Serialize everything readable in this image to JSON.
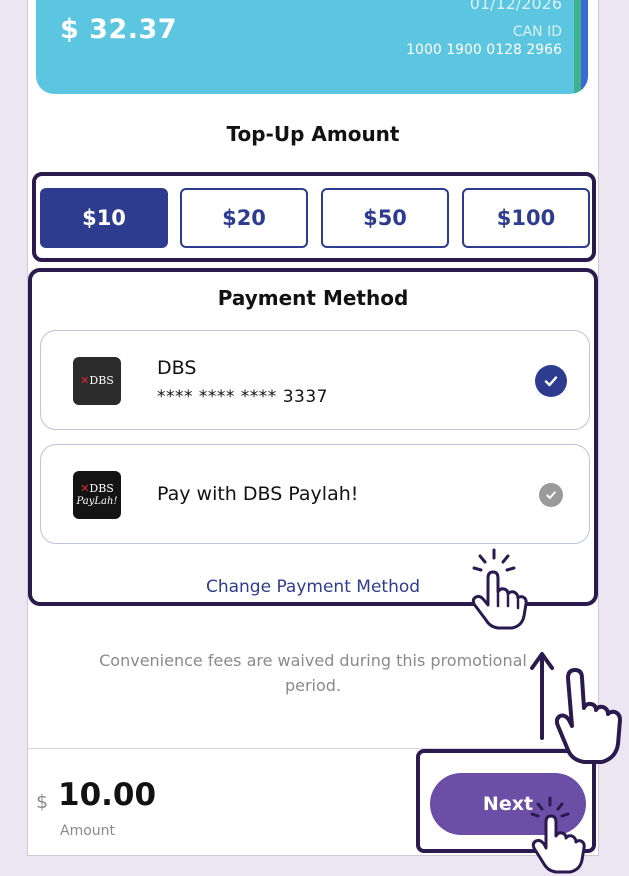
{
  "card": {
    "balance": "$ 32.37",
    "date": "01/12/2026",
    "can_label": "CAN ID",
    "can_id": "1000 1900 0128 2966"
  },
  "topup": {
    "title": "Top-Up Amount",
    "options": [
      "$10",
      "$20",
      "$50",
      "$100"
    ],
    "selected_index": 0
  },
  "payment": {
    "title": "Payment Method",
    "methods": [
      {
        "name": "DBS",
        "number": "**** **** **** 3337",
        "logo_text": "DBS",
        "selected": true
      },
      {
        "name": "Pay with DBS Paylah!",
        "logo_text": "DBS",
        "logo_sub": "PayLah!",
        "selected": false
      }
    ],
    "change_link": "Change Payment Method"
  },
  "notice": "Convenience fees are waived during this promotional period.",
  "footer": {
    "currency": "$",
    "total": "10.00",
    "amount_label": "Amount",
    "next_label": "Next"
  },
  "colors": {
    "primary": "#2e3c8f",
    "next": "#6b4fa6",
    "card": "#5cc5e0",
    "highlight": "#2b1a4e"
  }
}
